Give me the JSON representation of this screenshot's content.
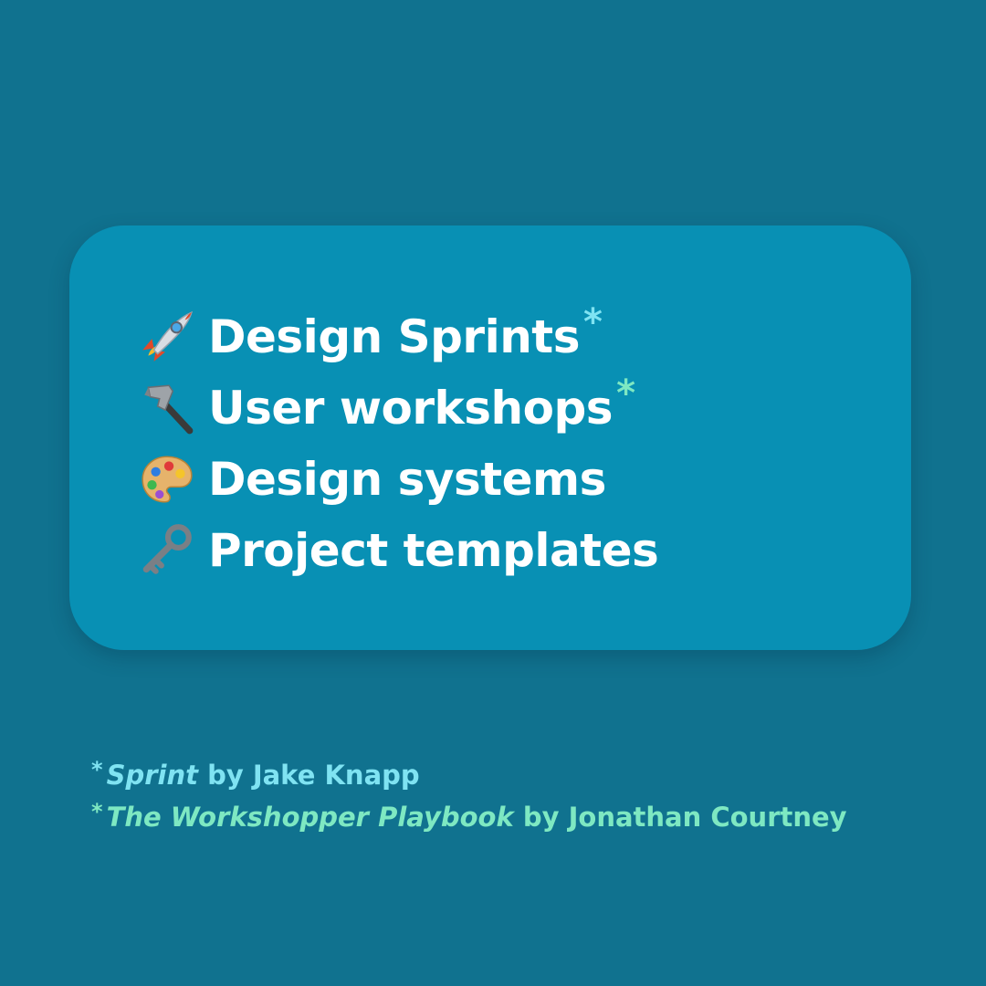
{
  "colors": {
    "background": "#10728f",
    "card": "#0890b4",
    "text": "#ffffff",
    "accent_cyan": "#7fe3f2",
    "accent_mint": "#7ee8c2"
  },
  "items": [
    {
      "icon": "rocket-icon",
      "label": "Design Sprints",
      "mark": "*"
    },
    {
      "icon": "hammer-icon",
      "label": "User workshops",
      "mark": "*"
    },
    {
      "icon": "palette-icon",
      "label": "Design systems",
      "mark": ""
    },
    {
      "icon": "key-icon",
      "label": "Project templates",
      "mark": ""
    }
  ],
  "footnotes": [
    {
      "mark": "*",
      "title": "Sprint",
      "rest": " by Jake Knapp"
    },
    {
      "mark": "*",
      "title": "The Workshopper Playbook",
      "rest": " by Jonathan Courtney"
    }
  ]
}
